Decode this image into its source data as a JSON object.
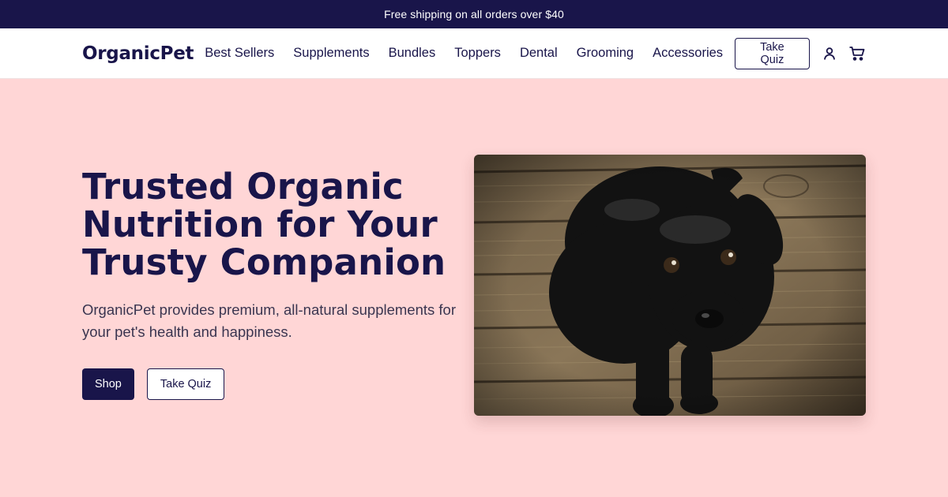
{
  "announcement": {
    "text": "Free shipping on all orders over $40"
  },
  "header": {
    "logo": "OrganicPet",
    "nav": [
      {
        "label": "Best Sellers"
      },
      {
        "label": "Supplements"
      },
      {
        "label": "Bundles"
      },
      {
        "label": "Toppers"
      },
      {
        "label": "Dental"
      },
      {
        "label": "Grooming"
      },
      {
        "label": "Accessories"
      }
    ],
    "quiz_button": "Take Quiz",
    "icons": {
      "account": "user-icon",
      "cart": "cart-icon"
    }
  },
  "hero": {
    "title_lines": [
      "Trusted Organic",
      "Nutrition for Your",
      "Trusty Companion"
    ],
    "subtitle_lines": [
      "OrganicPet provides premium, all-natural supplements for",
      "your pet's health and happiness."
    ],
    "shop_button": "Shop",
    "quiz_button": "Take Quiz"
  },
  "colors": {
    "brand_navy": "#19154a",
    "hero_background": "#ffd6d6",
    "header_background": "#ffffff"
  }
}
